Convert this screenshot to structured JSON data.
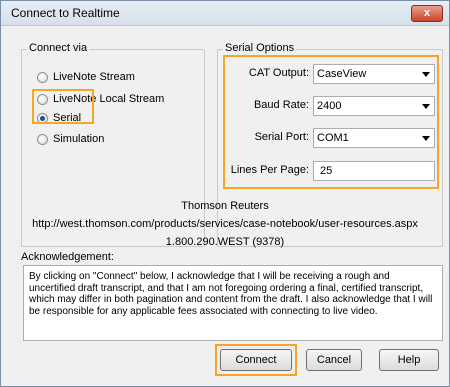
{
  "window": {
    "title": "Connect to Realtime",
    "close_glyph": "x"
  },
  "connect_via": {
    "legend": "Connect via",
    "options": [
      {
        "label": "LiveNote Stream",
        "checked": false
      },
      {
        "label": "LiveNote Local Stream",
        "checked": false
      },
      {
        "label": "Serial",
        "checked": true
      },
      {
        "label": "Simulation",
        "checked": false
      }
    ]
  },
  "serial_options": {
    "legend": "Serial Options",
    "cat_output": {
      "label": "CAT Output:",
      "value": "CaseView"
    },
    "baud_rate": {
      "label": "Baud Rate:",
      "value": "2400"
    },
    "serial_port": {
      "label": "Serial Port:",
      "value": "COM1"
    },
    "lines_per_page": {
      "label": "Lines Per Page:",
      "value": "25"
    }
  },
  "vendor": {
    "name": "Thomson Reuters",
    "url": "http://west.thomson.com/products/services/case-notebook/user-resources.aspx",
    "phone": "1.800.290.WEST (9378)"
  },
  "acknowledgement": {
    "label": "Acknowledgement:",
    "text": "By clicking on \"Connect\" below, I acknowledge that I will be receiving a rough and uncertified draft transcript, and that I am not foregoing ordering a final, certified transcript, which may differ in both pagination and content from the draft.  I also acknowledge that I will be responsible for any applicable fees associated with connecting to live video."
  },
  "buttons": {
    "connect": "Connect",
    "cancel": "Cancel",
    "help": "Help"
  },
  "colors": {
    "highlight": "#f5a623",
    "title_bar": "#dbe4ef",
    "close_button": "#c9452b"
  }
}
